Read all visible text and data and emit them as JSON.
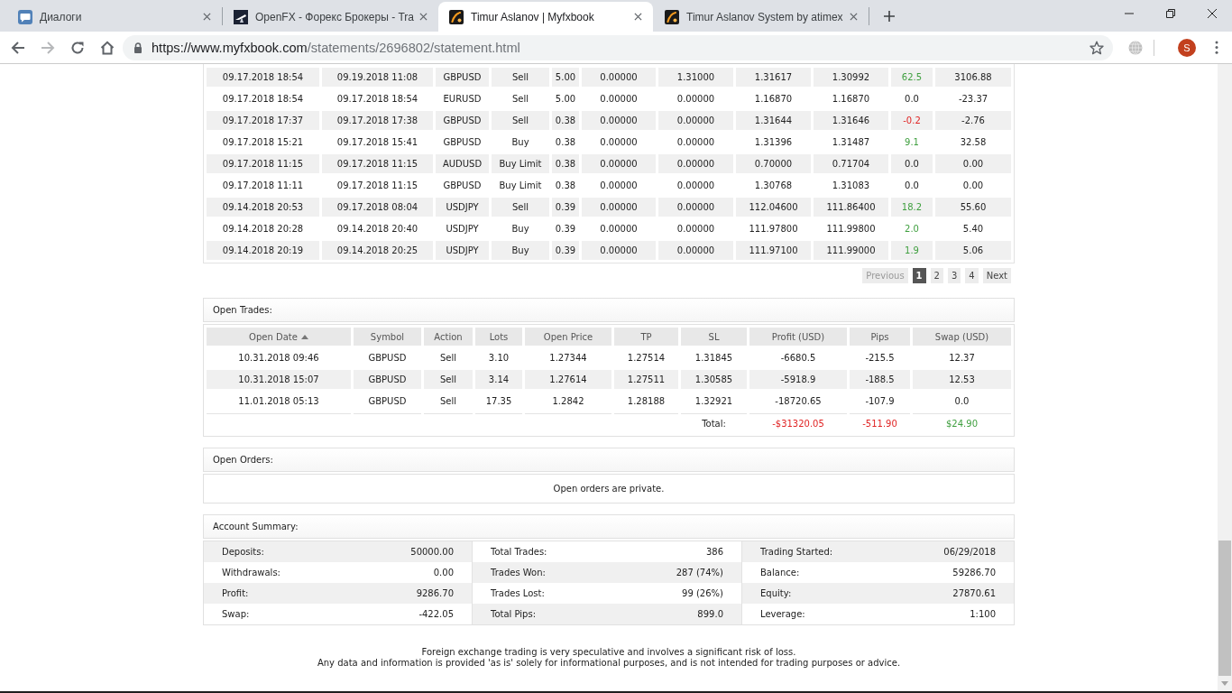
{
  "browser": {
    "tabs": [
      {
        "title": "Диалоги",
        "kind": "chat",
        "selected": false
      },
      {
        "title": "OpenFX - Форекс Брокеры - Tra",
        "kind": "site",
        "selected": false
      },
      {
        "title": "Timur Aslanov | Myfxbook",
        "kind": "fx",
        "selected": true
      },
      {
        "title": "Timur Aslanov System by atimex",
        "kind": "fx",
        "selected": false
      }
    ],
    "forward_disabled": true,
    "url": {
      "origin": "https://www.myfxbook.com",
      "path": "/statements/2696802/statement.html"
    },
    "profile_initial": "S"
  },
  "closed_trades": {
    "rows": [
      [
        "09.17.2018 18:54",
        "09.19.2018 11:08",
        "GBPUSD",
        "Sell",
        "5.00",
        "0.00000",
        "1.31000",
        "1.31617",
        "1.30992",
        {
          "text": "62.5",
          "color": "#3f9f3f"
        },
        "3106.88"
      ],
      [
        "09.17.2018 18:54",
        "09.17.2018 18:54",
        "EURUSD",
        "Sell",
        "5.00",
        "0.00000",
        "0.00000",
        "1.16870",
        "1.16870",
        "0.0",
        "-23.37"
      ],
      [
        "09.17.2018 17:37",
        "09.17.2018 17:38",
        "GBPUSD",
        "Sell",
        "0.38",
        "0.00000",
        "0.00000",
        "1.31644",
        "1.31646",
        {
          "text": "-0.2",
          "color": "#e02424"
        },
        "-2.76"
      ],
      [
        "09.17.2018 15:21",
        "09.17.2018 15:41",
        "GBPUSD",
        "Buy",
        "0.38",
        "0.00000",
        "0.00000",
        "1.31396",
        "1.31487",
        {
          "text": "9.1",
          "color": "#3f9f3f"
        },
        "32.58"
      ],
      [
        "09.17.2018 11:15",
        "09.17.2018 11:15",
        "AUDUSD",
        "Buy Limit",
        "0.38",
        "0.00000",
        "0.00000",
        "0.70000",
        "0.71704",
        "0.0",
        "0.00"
      ],
      [
        "09.17.2018 11:11",
        "09.17.2018 11:15",
        "GBPUSD",
        "Buy Limit",
        "0.38",
        "0.00000",
        "0.00000",
        "1.30768",
        "1.31083",
        "0.0",
        "0.00"
      ],
      [
        "09.14.2018 20:53",
        "09.17.2018 08:04",
        "USDJPY",
        "Sell",
        "0.39",
        "0.00000",
        "0.00000",
        "112.04600",
        "111.86400",
        {
          "text": "18.2",
          "color": "#3f9f3f"
        },
        "55.60"
      ],
      [
        "09.14.2018 20:28",
        "09.14.2018 20:40",
        "USDJPY",
        "Buy",
        "0.39",
        "0.00000",
        "0.00000",
        "111.97800",
        "111.99800",
        {
          "text": "2.0",
          "color": "#3f9f3f"
        },
        "5.40"
      ],
      [
        "09.14.2018 20:19",
        "09.14.2018 20:25",
        "USDJPY",
        "Buy",
        "0.39",
        "0.00000",
        "0.00000",
        "111.97100",
        "111.99000",
        {
          "text": "1.9",
          "color": "#3f9f3f"
        },
        "5.06"
      ]
    ],
    "pagination": {
      "previous": {
        "label": "Previous",
        "disabled": true
      },
      "pages": [
        {
          "label": "1",
          "selected": true
        },
        {
          "label": "2",
          "selected": false
        },
        {
          "label": "3",
          "selected": false
        },
        {
          "label": "4",
          "selected": false
        }
      ],
      "next": {
        "label": "Next",
        "disabled": false
      }
    }
  },
  "open_trades": {
    "title": "Open Trades:",
    "columns": [
      {
        "label": "Open Date",
        "sorted": true
      },
      {
        "label": "Symbol",
        "sorted": false
      },
      {
        "label": "Action",
        "sorted": false
      },
      {
        "label": "Lots",
        "sorted": false
      },
      {
        "label": "Open Price",
        "sorted": false
      },
      {
        "label": "TP",
        "sorted": false
      },
      {
        "label": "SL",
        "sorted": false
      },
      {
        "label": "Profit (USD)",
        "sorted": false
      },
      {
        "label": "Pips",
        "sorted": false
      },
      {
        "label": "Swap (USD)",
        "sorted": false
      }
    ],
    "rows": [
      [
        "10.31.2018 09:46",
        "GBPUSD",
        "Sell",
        "3.10",
        "1.27344",
        "1.27514",
        "1.31845",
        "-6680.5",
        "-215.5",
        "12.37"
      ],
      [
        "10.31.2018 15:07",
        "GBPUSD",
        "Sell",
        "3.14",
        "1.27614",
        "1.27511",
        "1.30585",
        "-5918.9",
        "-188.5",
        "12.53"
      ],
      [
        "11.01.2018 05:13",
        "GBPUSD",
        "Sell",
        "17.35",
        "1.2842",
        "1.28188",
        "1.32921",
        "-18720.65",
        "-107.9",
        "0.0"
      ]
    ],
    "total": {
      "label": "Total:",
      "values": [
        {
          "text": "-$31320.05",
          "color": "#e02424"
        },
        {
          "text": "-511.90",
          "color": "#e02424"
        },
        {
          "text": "$24.90",
          "color": "#3f9f3f"
        }
      ]
    }
  },
  "open_orders": {
    "title": "Open Orders:",
    "message": "Open orders are private."
  },
  "account_summary": {
    "title": "Account Summary:",
    "rows": [
      [
        {
          "label": "Deposits:",
          "value": "50000.00"
        },
        {
          "label": "Total Trades:",
          "value": "386"
        },
        {
          "label": "Trading Started:",
          "value": "06/29/2018"
        }
      ],
      [
        {
          "label": "Withdrawals:",
          "value": "0.00"
        },
        {
          "label": "Trades Won:",
          "value": "287 (74%)"
        },
        {
          "label": "Balance:",
          "value": "59286.70"
        }
      ],
      [
        {
          "label": "Profit:",
          "value": "9286.70"
        },
        {
          "label": "Trades Lost:",
          "value": "99 (26%)"
        },
        {
          "label": "Equity:",
          "value": "27870.61"
        }
      ],
      [
        {
          "label": "Swap:",
          "value": "-422.05"
        },
        {
          "label": "Total Pips:",
          "value": "899.0"
        },
        {
          "label": "Leverage:",
          "value": "1:100"
        }
      ]
    ]
  },
  "disclaimer": [
    "Foreign exchange trading is very speculative and involves a significant risk of loss.",
    "Any data and information is provided 'as is' solely for informational purposes, and is not intended for trading purposes or advice."
  ]
}
